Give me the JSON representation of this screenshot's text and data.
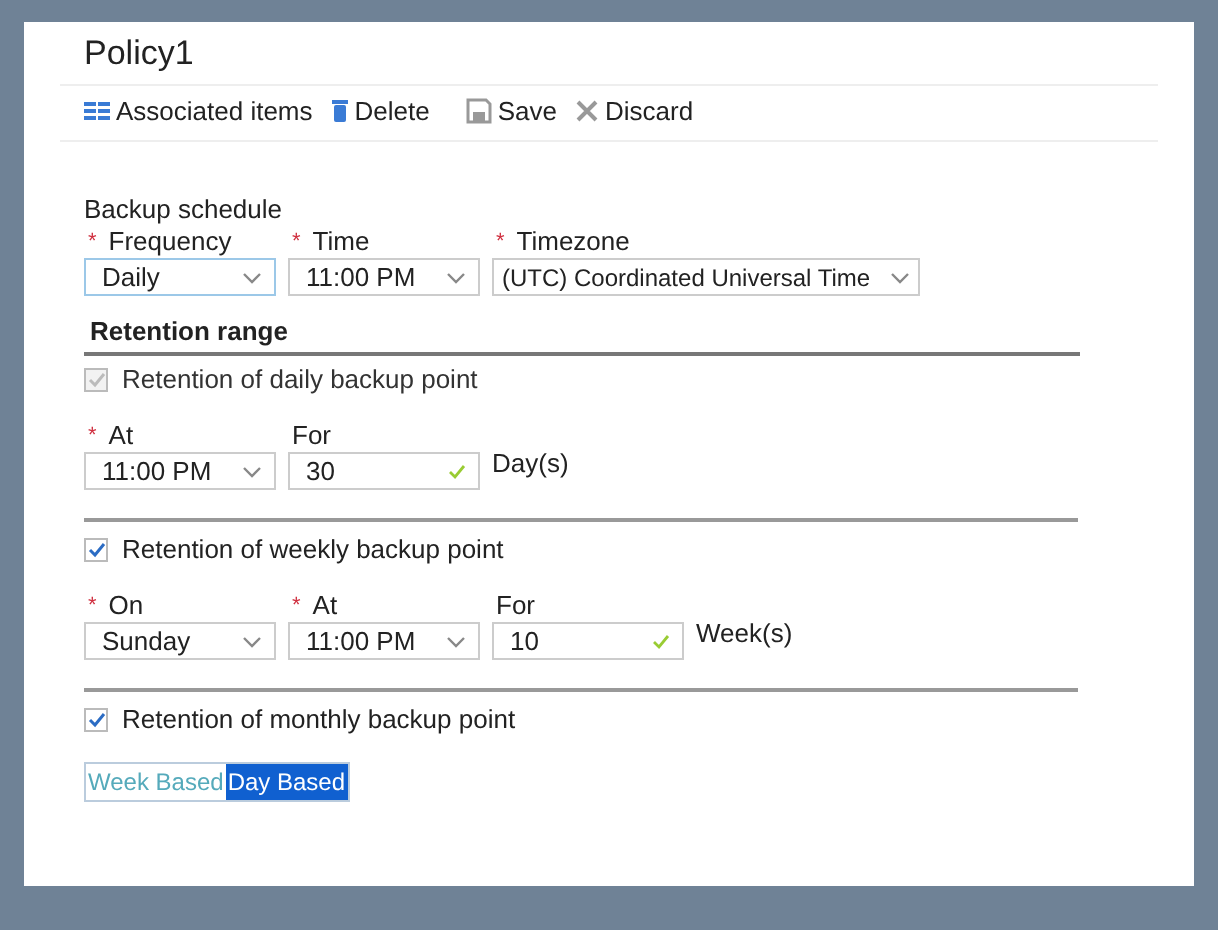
{
  "panel": {
    "title": "Policy1"
  },
  "toolbar": [
    {
      "label": "Associated items"
    },
    {
      "label": "Delete"
    },
    {
      "label": "Save"
    },
    {
      "label": "Discard"
    }
  ],
  "schedule": {
    "label": "Backup schedule",
    "fields": [
      {
        "label": "Frequency",
        "required_mark": "*",
        "kind": "select",
        "value": "Daily",
        "focused": true
      },
      {
        "label": "Time",
        "required_mark": "*",
        "kind": "select",
        "value": "11:00 PM",
        "focused": false
      },
      {
        "label": "Timezone",
        "required_mark": "*",
        "kind": "select",
        "value": "(UTC) Coordinated Universal Time",
        "focused": false
      }
    ]
  },
  "retention": {
    "title": "Retention range",
    "sections": [
      {
        "label": "Retention of daily backup point",
        "checked": true,
        "disabled": true,
        "unit": "Day(s)",
        "fields": [
          {
            "label": "At",
            "required_mark": "*",
            "kind": "select",
            "value": "11:00 PM",
            "focused": false
          },
          {
            "label": "For",
            "kind": "input",
            "value": "30",
            "valid": true
          }
        ]
      },
      {
        "label": "Retention of weekly backup point",
        "checked": true,
        "disabled": false,
        "unit": "Week(s)",
        "fields": [
          {
            "label": "On",
            "required_mark": "*",
            "kind": "select",
            "value": "Sunday",
            "focused": false
          },
          {
            "label": "At",
            "required_mark": "*",
            "kind": "select",
            "value": "11:00 PM",
            "focused": false
          },
          {
            "label": "For",
            "kind": "input",
            "value": "10",
            "valid": true
          }
        ]
      },
      {
        "label": "Retention of monthly backup point",
        "checked": true,
        "disabled": false
      }
    ]
  },
  "toggle": [
    {
      "label": "Week Based",
      "selected": false
    },
    {
      "label": "Day Based",
      "selected": true
    }
  ]
}
